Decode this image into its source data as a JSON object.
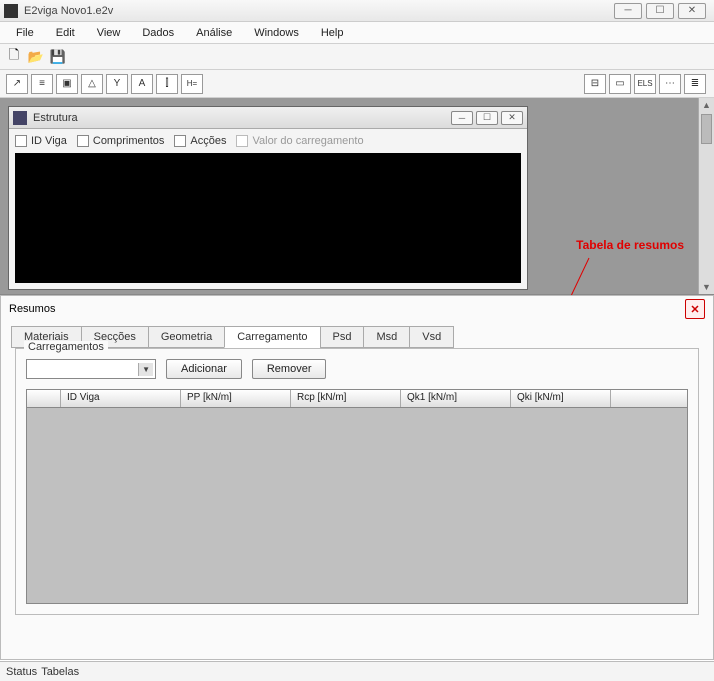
{
  "window": {
    "title": "E2viga  Novo1.e2v"
  },
  "menu": {
    "file": "File",
    "edit": "Edit",
    "view": "View",
    "dados": "Dados",
    "analise": "Análise",
    "windows": "Windows",
    "help": "Help"
  },
  "child": {
    "title": "Estrutura",
    "chk_idviga": "ID Viga",
    "chk_comprimentos": "Comprimentos",
    "chk_accoes": "Acções",
    "chk_valor": "Valor do carregamento"
  },
  "annotation": "Tabela de resumos",
  "resumos": {
    "title": "Resumos",
    "tabs": {
      "materiais": "Materiais",
      "seccoes": "Secções",
      "geometria": "Geometria",
      "carregamento": "Carregamento",
      "psd": "Psd",
      "msd": "Msd",
      "vsd": "Vsd"
    },
    "fieldset": "Carregamentos",
    "btn_add": "Adicionar",
    "btn_remove": "Remover",
    "columns": {
      "idviga": "ID Viga",
      "pp": "PP [kN/m]",
      "rcp": "Rcp [kN/m]",
      "qk1": "Qk1 [kN/m]",
      "qki": "Qki [kN/m]"
    }
  },
  "status": {
    "a": "Status",
    "b": "Tabelas"
  }
}
